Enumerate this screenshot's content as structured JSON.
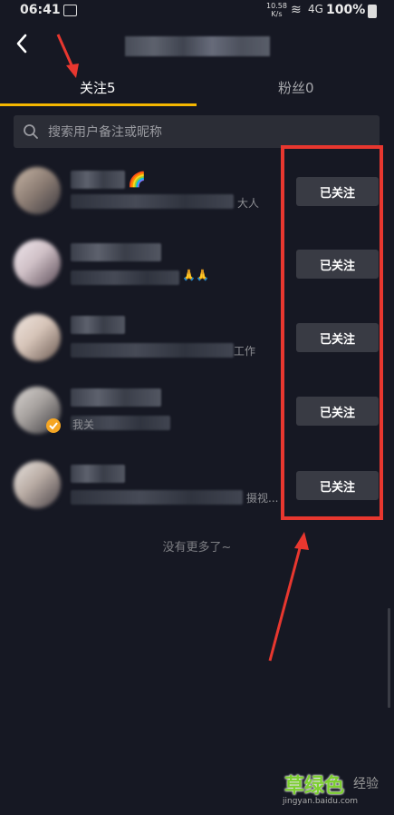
{
  "status_bar": {
    "time": "06:41",
    "net_speed_value": "10.58",
    "net_speed_unit": "K/s",
    "network": "4G",
    "battery": "100%"
  },
  "tabs": [
    {
      "label": "关注5",
      "active": true
    },
    {
      "label": "粉丝0",
      "active": false
    }
  ],
  "search": {
    "placeholder": "搜索用户备注或昵称"
  },
  "users": [
    {
      "desc_suffix": "大人",
      "emoji": "🌈",
      "button": "已关注"
    },
    {
      "desc_suffix": "🙏🙏",
      "emoji": "",
      "button": "已关注"
    },
    {
      "desc_suffix": "工作",
      "emoji": "",
      "button": "已关注"
    },
    {
      "desc_suffix": "我关",
      "emoji": "",
      "button": "已关注"
    },
    {
      "desc_suffix": "摄视...",
      "emoji": "",
      "button": "已关注"
    }
  ],
  "footer": {
    "no_more": "没有更多了~"
  },
  "watermark": {
    "main": "草绿色",
    "side": "经验",
    "url": "jingyan.baidu.com"
  },
  "colors": {
    "background": "#161823",
    "accent": "#f5b700",
    "button_bg": "#393b44",
    "annotation_red": "#e8372f"
  }
}
